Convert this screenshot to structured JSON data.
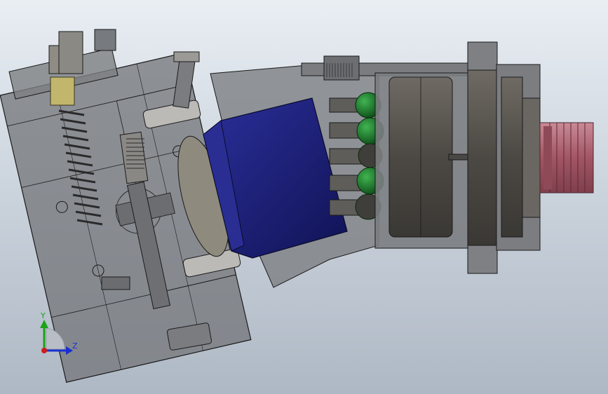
{
  "viewport": {
    "background_top": "#e9eef3",
    "background_bottom": "#aeb8c4"
  },
  "model": {
    "housing_color": "#7d7f82",
    "cylinder_block_color": "#1c1f78",
    "piston_ball_color": "#1c7a2a",
    "shaft_spline_color": "#b56a78",
    "edge_color": "#1a1a1a"
  },
  "triad": {
    "y_label": "Y",
    "z_label": "Z",
    "y_color": "#1aa31a",
    "z_color": "#1a2fd1",
    "x_color": "#d11a1a"
  }
}
